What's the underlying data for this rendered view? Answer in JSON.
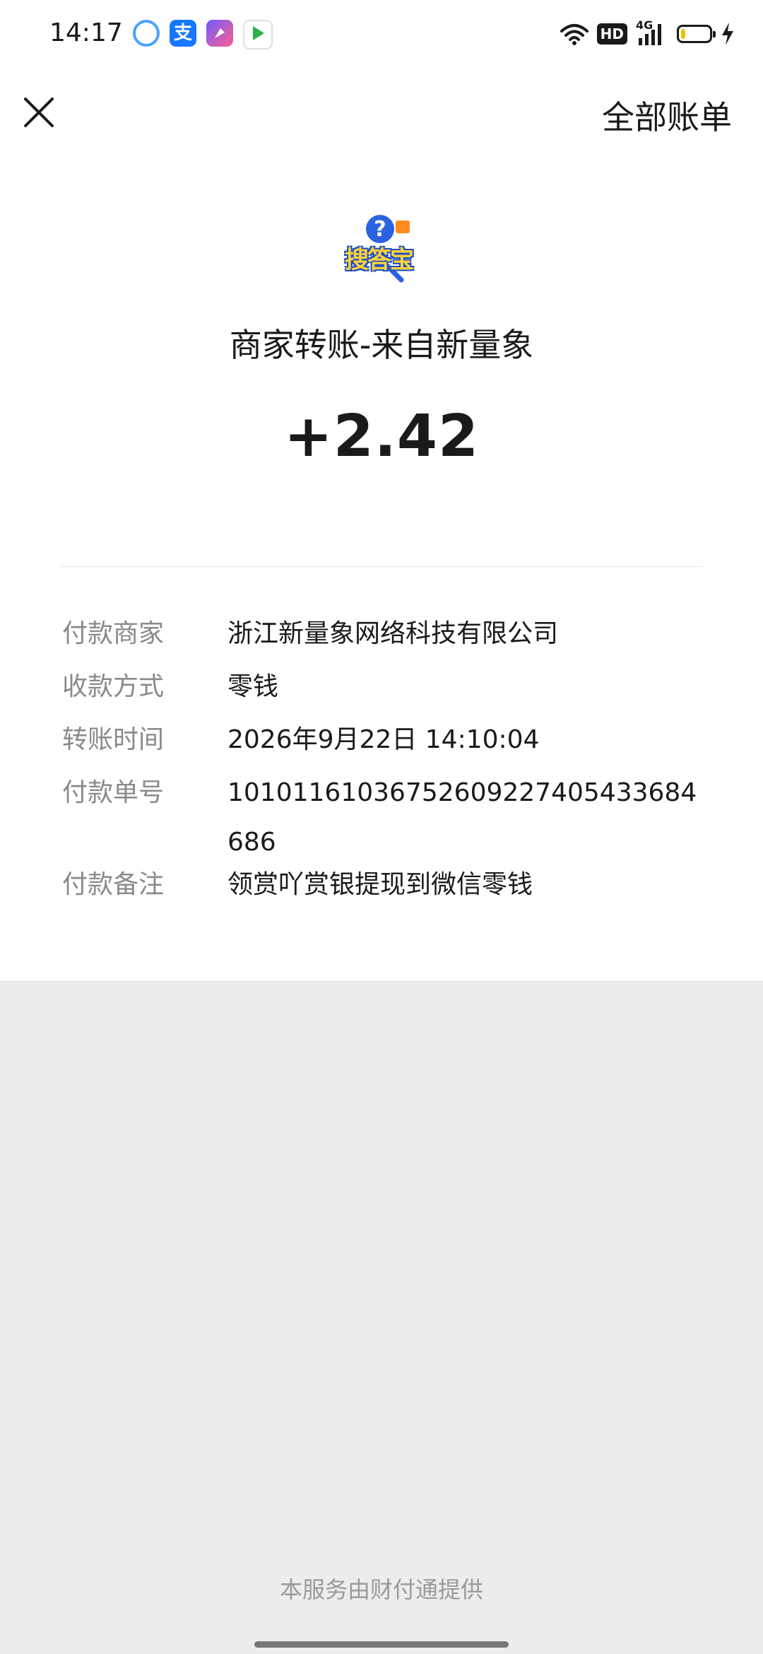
{
  "status_bar": {
    "time": "14:17",
    "app_icons": [
      "browser-icon",
      "alipay-icon",
      "video-editor-icon",
      "video-app-icon"
    ],
    "alipay_glyph": "支",
    "hd_badge": "HD",
    "network_label": "4G",
    "battery_level_percent": 15,
    "battery_color": "#f2c200"
  },
  "header": {
    "close_icon": "close-icon",
    "all_bills_label": "全部账单"
  },
  "merchant": {
    "logo_text": "搜答宝",
    "title": "商家转账-来自新量象",
    "amount": "+2.42"
  },
  "details": [
    {
      "label": "付款商家",
      "value": "浙江新量象网络科技有限公司"
    },
    {
      "label": "收款方式",
      "value": "零钱"
    },
    {
      "label": "转账时间",
      "value": "2026年9月22日 14:10:04"
    },
    {
      "label": "付款单号",
      "value": "10101161036752609227405433684686"
    },
    {
      "label": "付款备注",
      "value": "领赏吖赏银提现到微信零钱"
    }
  ],
  "footer": {
    "note": "本服务由财付通提供"
  },
  "colors": {
    "page_background": "#ededed",
    "card_background": "#ffffff",
    "label_color": "#8a8a8a",
    "text_color": "#1a1a1a"
  }
}
